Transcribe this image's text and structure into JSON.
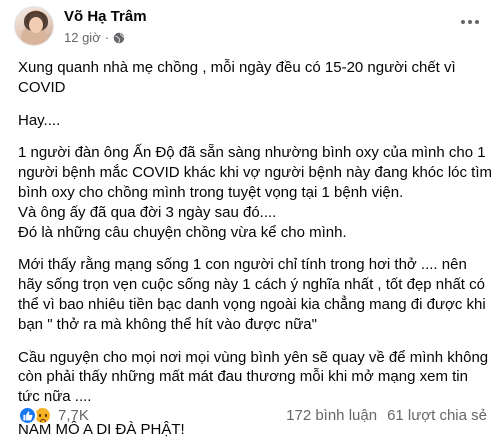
{
  "post": {
    "author": "Võ Hạ Trâm",
    "time": "12 giờ",
    "separator": "·",
    "privacy_icon": "globe-icon",
    "paragraphs": [
      "Xung quanh nhà mẹ chồng , mỗi ngày đều có 15-20 người chết vì COVID",
      "Hay....",
      "1 người đàn ông Ấn Độ đã sẵn sàng nhường bình oxy của mình cho 1 người bệnh mắc COVID khác khi vợ người bệnh này đang khóc lóc tìm bình oxy cho chồng mình trong tuyệt vọng tại 1 bệnh viện.\nVà ông ấy đã qua đời 3 ngày sau đó....\n Đó là những câu chuyện chồng vừa kể cho mình.",
      "Mới thấy rằng mạng sống 1 con người chỉ tính trong hơi thở .... nên hãy sống trọn vẹn cuộc sống này 1 cách ý nghĩa nhất , tốt đẹp nhất có thể vì bao nhiêu tiền bạc danh vọng ngoài kia chẳng mang đi được khi bạn \" thở ra mà không thể hít vào được nữa\"",
      "Cầu nguyện cho mọi nơi mọi vùng bình yên sẽ quay về để mình không còn phải thấy những mất mát đau thương mỗi khi mở mạng xem tin tức nữa ....",
      "NAM MÔ A DI ĐÀ PHẬT!"
    ]
  },
  "footer": {
    "reaction_icons": [
      "like-icon",
      "sad-icon"
    ],
    "reaction_count": "7,7K",
    "comments": "172 bình luận",
    "shares": "61 lượt chia sẻ"
  },
  "colors": {
    "text": "#050505",
    "secondary": "#65676b",
    "like_blue": "#1877f2",
    "sad_yellow": "#f7b125"
  }
}
